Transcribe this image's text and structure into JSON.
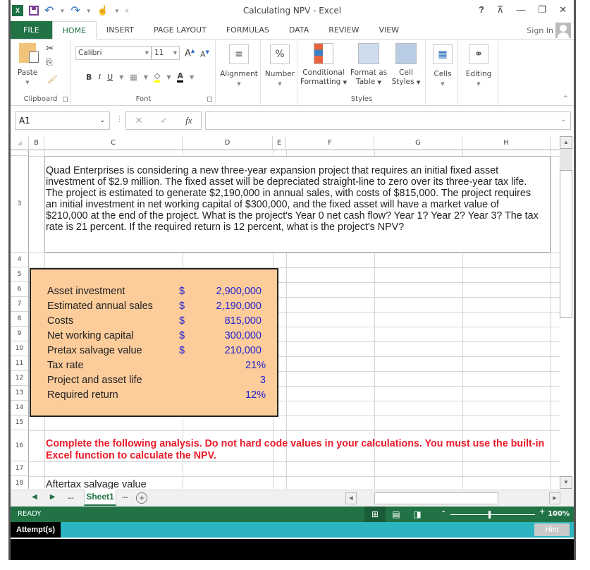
{
  "window": {
    "title": "Calculating NPV - Excel",
    "controls": [
      "?",
      "restore-ribbon",
      "minimize",
      "restore",
      "close"
    ]
  },
  "ribbon_tabs": [
    {
      "label": "FILE"
    },
    {
      "label": "HOME",
      "active": true
    },
    {
      "label": "INSERT"
    },
    {
      "label": "PAGE LAYOUT"
    },
    {
      "label": "FORMULAS"
    },
    {
      "label": "DATA"
    },
    {
      "label": "REVIEW"
    },
    {
      "label": "VIEW"
    }
  ],
  "account": {
    "sign_in": "Sign In"
  },
  "ribbon": {
    "clipboard": {
      "paste": "Paste",
      "group": "Clipboard"
    },
    "font": {
      "name": "Calibri",
      "size": "11",
      "bold": "B",
      "italic": "I",
      "underline": "U",
      "group": "Font"
    },
    "alignment": {
      "label": "Alignment"
    },
    "number": {
      "label": "Number",
      "icon_text": "%"
    },
    "styles": {
      "conditional_1": "Conditional",
      "conditional_2": "Formatting",
      "format_table_1": "Format as",
      "format_table_2": "Table",
      "cell_styles_1": "Cell",
      "cell_styles_2": "Styles",
      "group": "Styles"
    },
    "cells": {
      "label": "Cells"
    },
    "editing": {
      "label": "Editing"
    }
  },
  "formula_bar": {
    "name_box": "A1",
    "fx": "fx",
    "content": ""
  },
  "columns": [
    "B",
    "C",
    "D",
    "E",
    "F",
    "G",
    "H"
  ],
  "rows": [
    "3",
    "4",
    "5",
    "6",
    "7",
    "8",
    "9",
    "10",
    "11",
    "12",
    "13",
    "14",
    "15",
    "16",
    "17",
    "18"
  ],
  "problem_text": "Quad Enterprises is considering a new three-year expansion project that requires an initial fixed asset investment of $2.9 million. The fixed asset will be depreciated straight-line to zero over its three-year tax life. The project is estimated to generate $2,190,000 in annual sales, with costs of $815,000. The project requires an initial investment in net working capital of $300,000, and the fixed asset will have a market value of $210,000 at the end of the project. What is the project's Year 0 net cash flow? Year 1? Year 2? Year 3? The tax rate is 21 percent. If the required return is 12 percent, what is the project's NPV?",
  "inputs": [
    {
      "label": "Asset investment",
      "currency": "$",
      "value": "2,900,000"
    },
    {
      "label": "Estimated annual sales",
      "currency": "$",
      "value": "2,190,000"
    },
    {
      "label": "Costs",
      "currency": "$",
      "value": "815,000"
    },
    {
      "label": "Net working capital",
      "currency": "$",
      "value": "300,000"
    },
    {
      "label": "Pretax salvage value",
      "currency": "$",
      "value": "210,000"
    },
    {
      "label": "Tax rate",
      "currency": "",
      "value": "21%"
    },
    {
      "label": "Project and asset life",
      "currency": "",
      "value": "3"
    },
    {
      "label": "Required return",
      "currency": "",
      "value": "12%"
    }
  ],
  "instruction": "Complete the following analysis. Do not hard code values in your calculations. You must use the built-in Excel function to calculate the NPV.",
  "row18_label": "Aftertax salvage value",
  "sheets": {
    "active": "Sheet1",
    "more": "...",
    "add": "+"
  },
  "status": {
    "mode": "READY",
    "zoom": "100%",
    "zoom_minus": "-",
    "zoom_plus": "+"
  },
  "attempt_bar": {
    "attempts": "Attempt(s)",
    "hint": "Hint"
  },
  "colors": {
    "excel_green": "#217346",
    "input_fill": "#fccc9b",
    "input_blue": "#2323d2",
    "instruction_red": "#ea1c2b",
    "attempt_teal": "#2bb3c0"
  }
}
